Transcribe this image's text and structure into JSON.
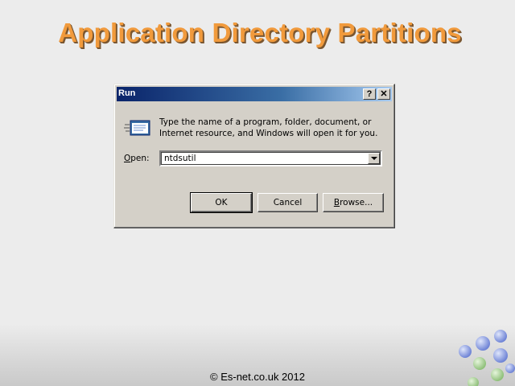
{
  "slide": {
    "title": "Application Directory Partitions",
    "footer": "© Es-net.co.uk 2012"
  },
  "dialog": {
    "title": "Run",
    "help_label": "?",
    "close_label": "✕",
    "description": "Type the name of a program, folder, document, or Internet resource, and Windows will open it for you.",
    "open_label_underlined": "O",
    "open_label_rest": "pen:",
    "combo_value": "ntdsutil",
    "ok_label": "OK",
    "cancel_label": "Cancel",
    "browse_label_underlined": "B",
    "browse_label_rest": "rowse..."
  },
  "colors": {
    "title_orange": "#f19a3c",
    "dialog_face": "#d4d0c8",
    "titlebar_start": "#0a246a",
    "titlebar_end": "#a6caf0"
  }
}
